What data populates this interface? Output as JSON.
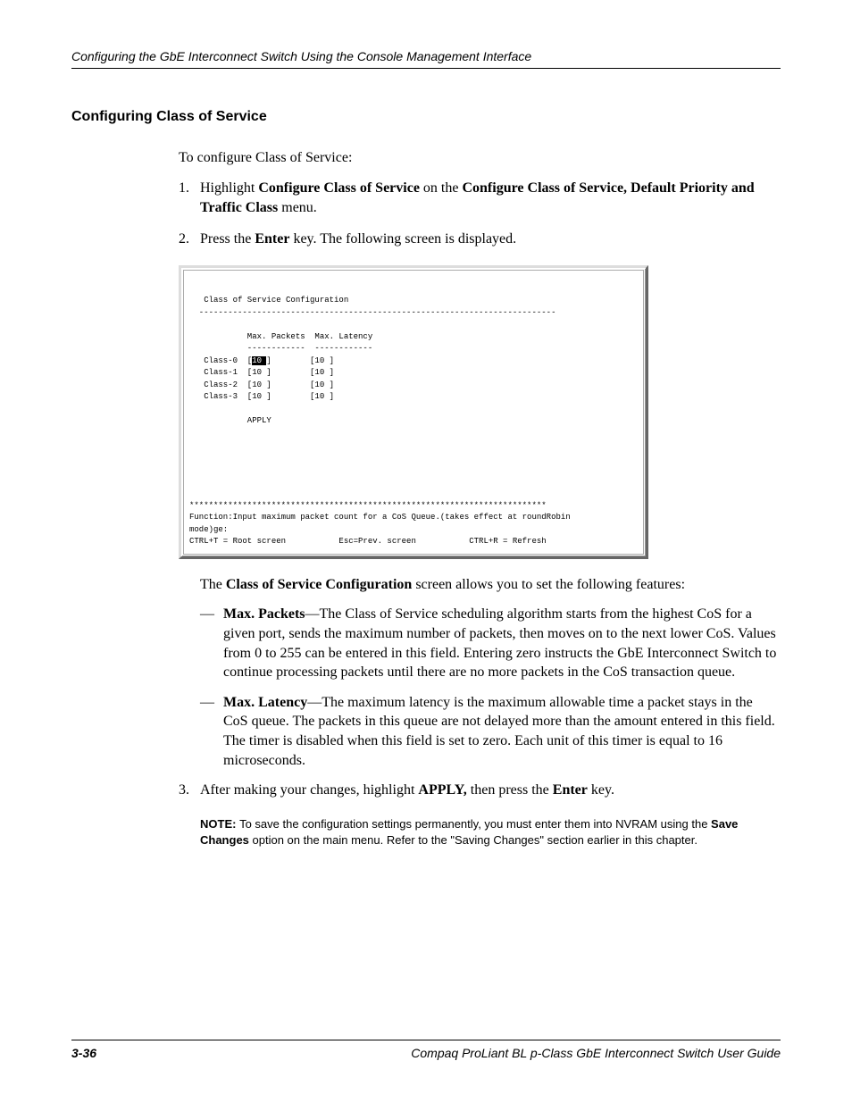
{
  "header": {
    "text": "Configuring the GbE Interconnect Switch Using the Console Management Interface"
  },
  "section": {
    "heading": "Configuring Class of Service",
    "intro": "To configure Class of Service:"
  },
  "step1": {
    "number": "1.",
    "pre": "Highlight ",
    "bold1": "Configure Class of Service",
    "mid": " on the ",
    "bold2": "Configure Class of Service, Default Priority and Traffic Class",
    "post": " menu."
  },
  "step2": {
    "number": "2.",
    "pre": "Press the ",
    "bold1": "Enter",
    "post": " key. The following screen is displayed."
  },
  "screenshot": {
    "title": "   Class of Service Configuration",
    "div": "  --------------------------------------------------------------------------",
    "hdr": "            Max. Packets  Max. Latency",
    "hdrunder": "            ------------  ------------",
    "r0a": "   Class-0  [",
    "r0hl": "10 ",
    "r0b": "]        [10 ]",
    "r1": "   Class-1  [10 ]        [10 ]",
    "r2": "   Class-2  [10 ]        [10 ]",
    "r3": "   Class-3  [10 ]        [10 ]",
    "apply": "            APPLY",
    "stars": "**************************************************************************",
    "func": "Function:Input maximum packet count for a CoS Queue.(takes effect at roundRobin",
    "mode": "mode)ge:",
    "nav": "CTRL+T = Root screen           Esc=Prev. screen           CTRL+R = Refresh"
  },
  "afterScreen": {
    "pre": "The ",
    "bold": "Class of Service Configuration",
    "post": " screen allows you to set the following features:"
  },
  "dash1": {
    "bold": "Max. Packets",
    "text": "—The Class of Service scheduling algorithm starts from the highest CoS for a given port, sends the maximum number of packets, then moves on to the next lower CoS. Values from 0 to 255 can be entered in this field. Entering zero instructs the GbE Interconnect Switch to continue processing packets until there are no more packets in the CoS transaction queue."
  },
  "dash2": {
    "bold": "Max. Latency",
    "text": "—The maximum latency is the maximum allowable time a packet stays in the CoS queue. The packets in this queue are not delayed more than the amount entered in this field. The timer is disabled when this field is set to zero. Each unit of this timer is equal to 16 microseconds."
  },
  "step3": {
    "number": "3.",
    "pre": "After making your changes, highlight ",
    "bold1": "APPLY,",
    "mid": " then press the ",
    "bold2": "Enter",
    "post": " key."
  },
  "note": {
    "label": "NOTE:  ",
    "pre": "To save the configuration settings permanently, you must enter them into NVRAM using the ",
    "bold": "Save Changes",
    "post": " option on the main menu. Refer to the \"Saving Changes\" section earlier in this chapter."
  },
  "footer": {
    "left": "3-36",
    "right": "Compaq ProLiant BL p-Class GbE Interconnect Switch User Guide"
  }
}
